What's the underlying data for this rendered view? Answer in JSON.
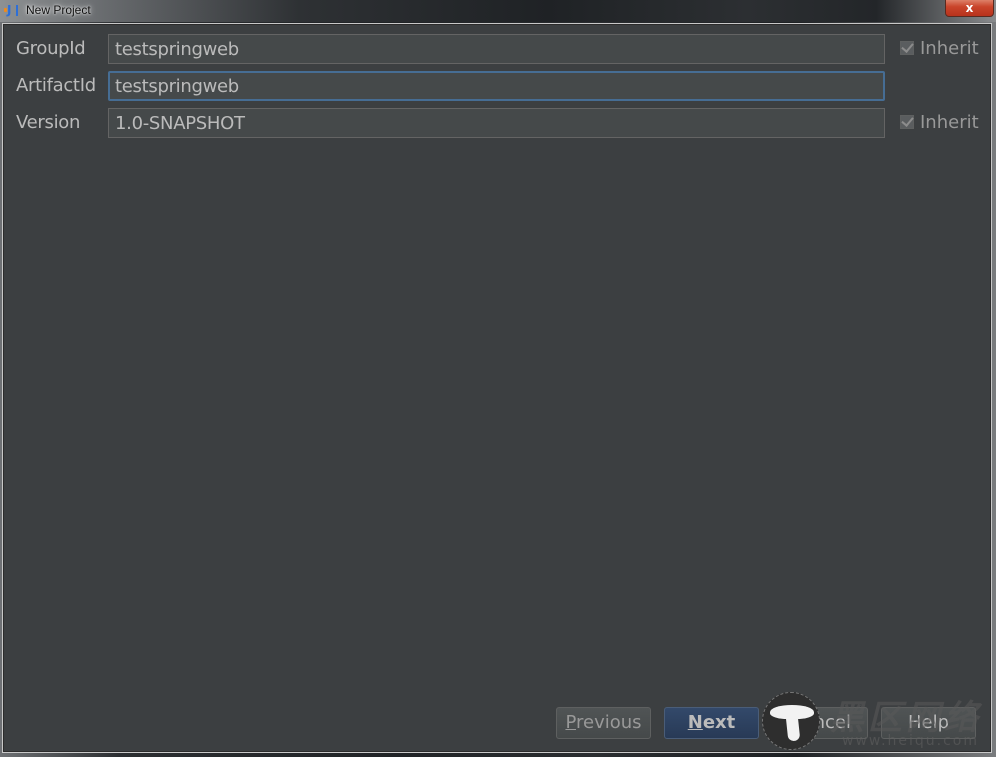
{
  "window": {
    "title": "New Project",
    "app_icon": "intellij-idea-icon",
    "close_label": "x"
  },
  "form": {
    "fields": [
      {
        "label": "GroupId",
        "value": "testspringweb",
        "inherit": {
          "label": "Inherit",
          "checked": true
        }
      },
      {
        "label": "ArtifactId",
        "value": "testspringweb",
        "focused": true
      },
      {
        "label": "Version",
        "value": "1.0-SNAPSHOT",
        "inherit": {
          "label": "Inherit",
          "checked": true
        }
      }
    ]
  },
  "buttons": {
    "previous": {
      "mnemonic": "P",
      "rest": "revious"
    },
    "next": {
      "mnemonic": "N",
      "rest": "ext"
    },
    "cancel": {
      "label": "Cancel"
    },
    "help": {
      "label": "Help"
    }
  },
  "watermark": {
    "text": "黑区网络",
    "url": "www.heiqu.com"
  },
  "colors": {
    "dialog_bg": "#3c3f41",
    "field_bg": "#45494a",
    "focus_border": "#466d94",
    "default_button": "#2c3f5e",
    "text": "#bbbbbb"
  }
}
